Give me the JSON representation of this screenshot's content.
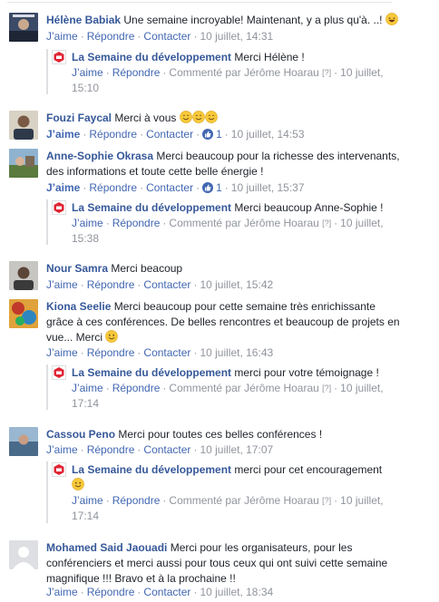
{
  "labels": {
    "like": "J’aime",
    "reply": "Répondre",
    "contact": "Contacter",
    "sep": "·",
    "commented_by": "Commenté par Jérôme Hoarau",
    "help": "[?]"
  },
  "page_name": "La Semaine du développement",
  "comments": [
    {
      "author": "Hélène Babiak",
      "text": "Une semaine incroyable! Maintenant, y a plus qu'à. ..!",
      "emoji": "laugh",
      "timestamp": "10 juillet, 14:31",
      "reply": {
        "text": "Merci Hélène !",
        "timestamp": "10 juillet,",
        "timestamp2": "15:10"
      }
    },
    {
      "author": "Fouzi Faycal",
      "text": "Merci à vous",
      "emoji": "smile3",
      "timestamp": "10 juillet, 14:53",
      "likes": "1",
      "liked": true
    },
    {
      "author": "Anne-Sophie Okrasa",
      "text": "Merci beaucoup pour la richesse des intervenants,",
      "text2": "des informations et toute cette belle énergie !",
      "timestamp": "10 juillet, 15:37",
      "likes": "1",
      "liked": true,
      "reply": {
        "text": "Merci beaucoup Anne-Sophie !",
        "timestamp": "10 juillet,",
        "timestamp2": "15:38"
      }
    },
    {
      "author": "Nour Samra",
      "text": "Merci beacoup",
      "timestamp": "10 juillet, 15:42"
    },
    {
      "author": "Kiona Seelie",
      "text": "Merci beaucoup pour cette semaine très enrichissante",
      "text2": "grâce à ces conférences. De belles rencontres et beaucoup de projets en",
      "text3": "vue... Merci",
      "emoji": "smile",
      "timestamp": "10 juillet, 16:43",
      "reply": {
        "text": "merci pour votre témoignage !",
        "timestamp": "10 juillet,",
        "timestamp2": "17:14"
      }
    },
    {
      "author": "Cassou Peno",
      "text": "Merci pour toutes ces belles conférences !",
      "timestamp": "10 juillet, 17:07",
      "reply": {
        "text": "merci pour cet encouragement",
        "emoji": "smile",
        "timestamp": "10 juillet,",
        "timestamp2": "17:14"
      }
    },
    {
      "author": "Mohamed Said Jaouadi",
      "text": "Merci pour les organisateurs, pour les",
      "text2": "conférenciers et merci aussi pour tous ceux qui ont suivi cette semaine",
      "text3": "magnifique !!! Bravo et à la prochaine !!",
      "timestamp": "10 juillet, 18:34"
    }
  ],
  "colors": {
    "link": "#365899",
    "action": "#4267b2",
    "muted": "#90949c",
    "logo_red": "#e02433"
  }
}
